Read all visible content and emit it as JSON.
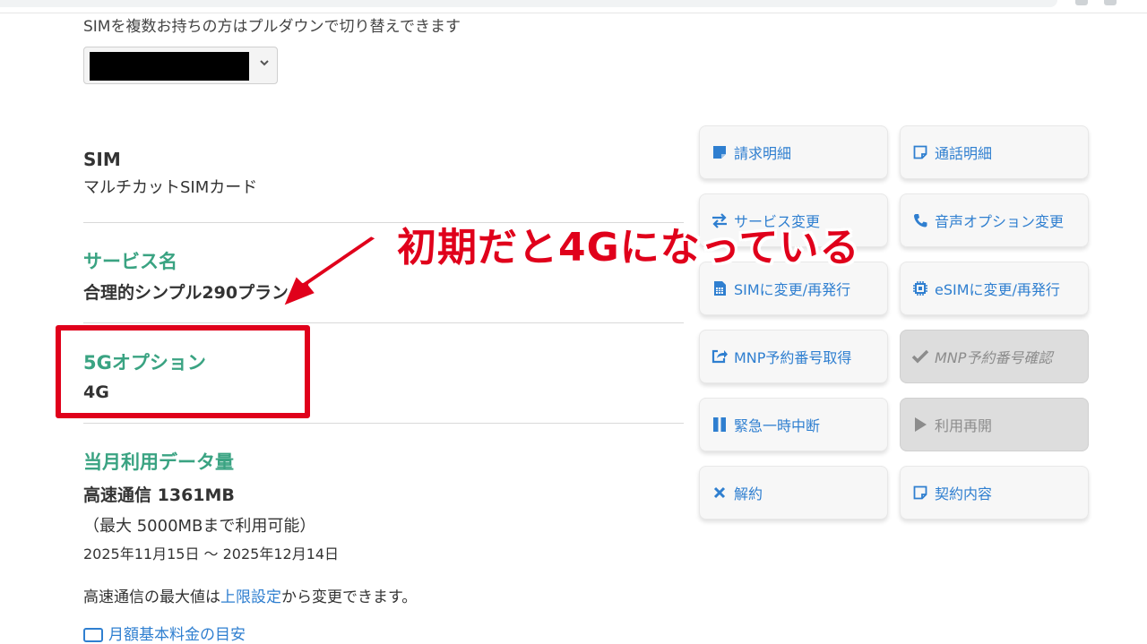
{
  "sim_selector": {
    "note": "SIMを複数お持ちの方はプルダウンで切り替えできます"
  },
  "details": {
    "sim": {
      "label": "SIM",
      "value": "マルチカットSIMカード"
    },
    "service": {
      "label": "サービス名",
      "value": "合理的シンプル290プラン"
    },
    "option_5g": {
      "label": "5Gオプション",
      "value": "4G"
    },
    "data_usage": {
      "label": "当月利用データ量",
      "speed_prefix": "高速通信",
      "amount": "1361MB",
      "limit": "（最大 5000MBまで利用可能）",
      "period": "2025年11月15日 〜 2025年12月14日"
    },
    "cap_note": {
      "before": "高速通信の最大値は",
      "link": "上限設定",
      "after": "から変更できます。"
    },
    "footer_link": "月額基本料金の目安"
  },
  "annotation": {
    "text": "初期だと4Gになっている",
    "color": "#e0001b"
  },
  "actions": [
    {
      "label": "請求明細",
      "icon": "document-icon",
      "disabled": false
    },
    {
      "label": "通話明細",
      "icon": "note-icon",
      "disabled": false
    },
    {
      "label": "サービス変更",
      "icon": "swap-icon",
      "disabled": false
    },
    {
      "label": "音声オプション変更",
      "icon": "phone-icon",
      "disabled": false
    },
    {
      "label": "SIMに変更/再発行",
      "icon": "sim-card-icon",
      "disabled": false
    },
    {
      "label": "eSIMに変更/再発行",
      "icon": "chip-icon",
      "disabled": false
    },
    {
      "label": "MNP予約番号取得",
      "icon": "share-icon",
      "disabled": false
    },
    {
      "label": "MNP予約番号確認",
      "icon": "check-icon",
      "disabled": true
    },
    {
      "label": "緊急一時中断",
      "icon": "pause-icon",
      "disabled": false
    },
    {
      "label": "利用再開",
      "icon": "play-icon",
      "disabled": true
    },
    {
      "label": "解約",
      "icon": "close-icon",
      "disabled": false
    },
    {
      "label": "契約内容",
      "icon": "note-icon",
      "disabled": false
    }
  ],
  "colors": {
    "accent_green": "#3aa382",
    "link_blue": "#2f7fd0",
    "annotation_red": "#e0001b"
  }
}
